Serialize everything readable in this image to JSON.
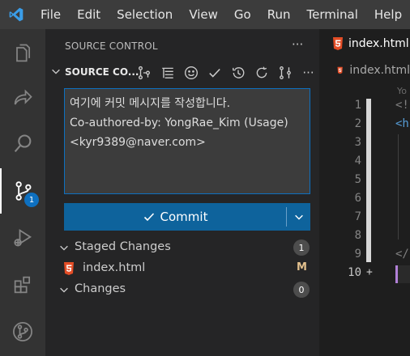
{
  "menu": [
    "File",
    "Edit",
    "Selection",
    "View",
    "Go",
    "Run",
    "Terminal",
    "Help"
  ],
  "activity_bar": {
    "items": [
      {
        "name": "explorer-icon"
      },
      {
        "name": "remote-share-icon"
      },
      {
        "name": "search-icon"
      },
      {
        "name": "source-control-icon",
        "badge": "1",
        "active": true
      },
      {
        "name": "run-debug-icon"
      },
      {
        "name": "extensions-icon"
      },
      {
        "name": "git-graph-icon"
      }
    ]
  },
  "sidebar": {
    "header": "SOURCE CONTROL",
    "more": "···",
    "section_title": "SOURCE CO...",
    "section_more": "···",
    "toolbar_icons": [
      "branch-compare-icon",
      "tree-list-icon",
      "smiley-icon",
      "check-icon",
      "history-icon",
      "refresh-icon",
      "commit-graph-icon"
    ],
    "commit_message": {
      "line1": "여기에 커밋 메시지를 작성합니다.",
      "line2": "",
      "line3": "",
      "line4": "Co-authored-by: YongRae_Kim (Usage)",
      "line5": "<kyr9389@naver.com>"
    },
    "commit_button": {
      "label": "Commit"
    },
    "staged": {
      "label": "Staged Changes",
      "count": "1",
      "files": [
        {
          "name": "index.html",
          "status": "M"
        }
      ]
    },
    "changes": {
      "label": "Changes",
      "count": "0"
    }
  },
  "editor": {
    "tab": "index.html",
    "breadcrumb": "index.html",
    "faded_text": "Yo",
    "line_numbers": [
      "1",
      "2",
      "3",
      "4",
      "5",
      "6",
      "7",
      "8",
      "9",
      "10"
    ],
    "code": [
      "<!",
      "<h",
      "",
      "",
      "",
      "",
      "",
      "",
      "</",
      ""
    ],
    "gutter_mark": "+"
  },
  "colors": {
    "accent": "#0e639c",
    "badge": "#0e70c0",
    "html_icon": "#e44d26",
    "modified": "#e2c08d"
  }
}
